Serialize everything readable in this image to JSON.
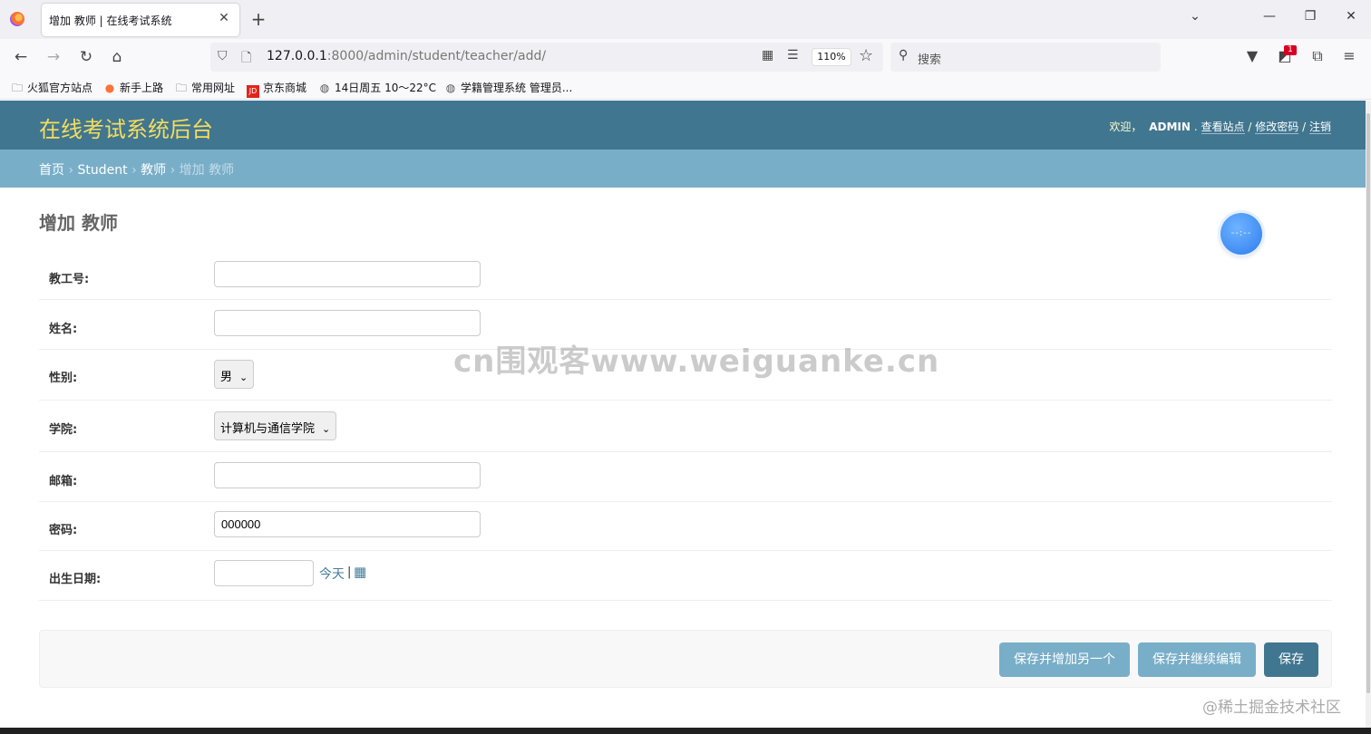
{
  "browser": {
    "tab_title": "增加 教师 | 在线考试系统",
    "tab_close": "✕",
    "new_tab": "+",
    "url_host": "127.0.0.1",
    "url_rest": ":8000/admin/student/teacher/add/",
    "zoom": "110%",
    "search_placeholder": "搜索",
    "notification_badge": "1",
    "bookmarks": [
      "火狐官方站点",
      "新手上路",
      "常用网址",
      "京东商城",
      "14日周五  10～22°C",
      "学籍管理系统 管理员..."
    ],
    "jd_logo": "JD"
  },
  "header": {
    "branding": "在线考试系统后台",
    "welcome": "欢迎，",
    "username": "ADMIN",
    "view_site": "查看站点",
    "change_password": "修改密码",
    "logout": "注销",
    "slash": "/"
  },
  "breadcrumbs": {
    "home": "首页",
    "app": "Student",
    "model": "教师",
    "current": "增加 教师",
    "sep": "›"
  },
  "page": {
    "title": "增加 教师",
    "float_text": "--:--"
  },
  "form": {
    "teacher_id_label": "教工号:",
    "name_label": "姓名:",
    "gender_label": "性别:",
    "gender_value": "男",
    "college_label": "学院:",
    "college_value": "计算机与通信学院",
    "email_label": "邮箱:",
    "password_label": "密码:",
    "password_value": "000000",
    "birthday_label": "出生日期:",
    "today_link": "今天",
    "link_sep": "|"
  },
  "buttons": {
    "save_add_another": "保存并增加另一个",
    "save_continue": "保存并继续编辑",
    "save": "保存"
  },
  "watermark": "cn围观客www.weiguanke.cn",
  "footer_watermark": "@稀土掘金技术社区",
  "colors": {
    "header_bg": "#417690",
    "breadcrumb_bg": "#79aec8",
    "branding": "#f5dd5d",
    "link": "#447e9b"
  }
}
